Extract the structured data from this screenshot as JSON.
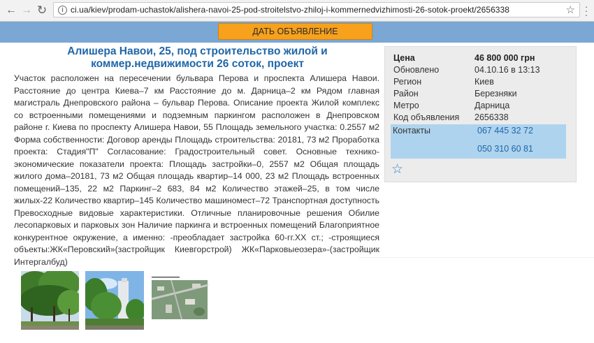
{
  "browser": {
    "url": "ci.ua/kiev/prodam-uchastok/alishera-navoi-25-pod-stroitelstvo-zhiloj-i-kommernedvizhimosti-26-sotok-proekt/2656338"
  },
  "header": {
    "post_button": "ДАТЬ ОБЪЯВЛЕНИЕ"
  },
  "listing": {
    "title_line1": "Алишера Навои, 25, под строительство жилой и",
    "title_line2": "коммер.недвижимости 26 соток, проект",
    "description": "Участок расположен на пересечении бульвара Перова и проспекта Алишера Навои. Расстояние до центра Киева–7 км Расстояние до м. Дарница–2 км Рядом главная магистраль Днепровского района – бульвар Перова. Описание проекта Жилой комплекс со встроенными помещениями и подземным паркингом расположен в Днепровском районе г. Киева по проспекту Алишера Навои, 55 Площадь земельного участка: 0.2557 м2 Форма собственности: Договор аренды Площадь строительства: 20181, 73 м2 Проработка проекта: Стадия\"П\" Согласование: Градостроительный совет. Основные технико-экономические показатели проекта: Площадь застройки–0, 2557 м2 Общая площадь жилого дома–20181, 73 м2 Общая площадь квартир–14 000, 23 м2 Площадь встроенных помещений–135, 22 м2 Паркинг–2 683, 84 м2 Количество этажей–25, в том числе жилых-22 Количество квартир–145 Количество машиномест–72 Транспортная доступность Превосходные видовые характеристики. Отличные планировочные решения Обилие лесопарковых и парковых зон Наличие паркинга и встроенных помещений Благоприятное конкурентное окружение, а именно: -преобладает застройка 60-гг.XX ст.; -строящиеся объекты:ЖК«Перовский»(застройщик Киевгорстрой) ЖК«Парковыеозера»-(застройщик Интергалбуд)"
  },
  "info": {
    "price_label": "Цена",
    "price_value": "46 800 000 грн",
    "updated_label": "Обновлено",
    "updated_value": "04.10.16 в 13:13",
    "region_label": "Регион",
    "region_value": "Киев",
    "district_label": "Район",
    "district_value": "Березняки",
    "metro_label": "Метро",
    "metro_value": "Дарница",
    "code_label": "Код объявления",
    "code_value": "2656338",
    "contacts_label": "Контакты",
    "phone1": "067 445 32 72",
    "phone2": "050 310 60 81"
  },
  "icons": {
    "favorite": "star-outline-icon"
  },
  "colors": {
    "title_blue": "#1f66a8",
    "band_blue": "#7aa7d4",
    "button_orange": "#f7a11c",
    "contacts_bg": "#aed3ee"
  }
}
